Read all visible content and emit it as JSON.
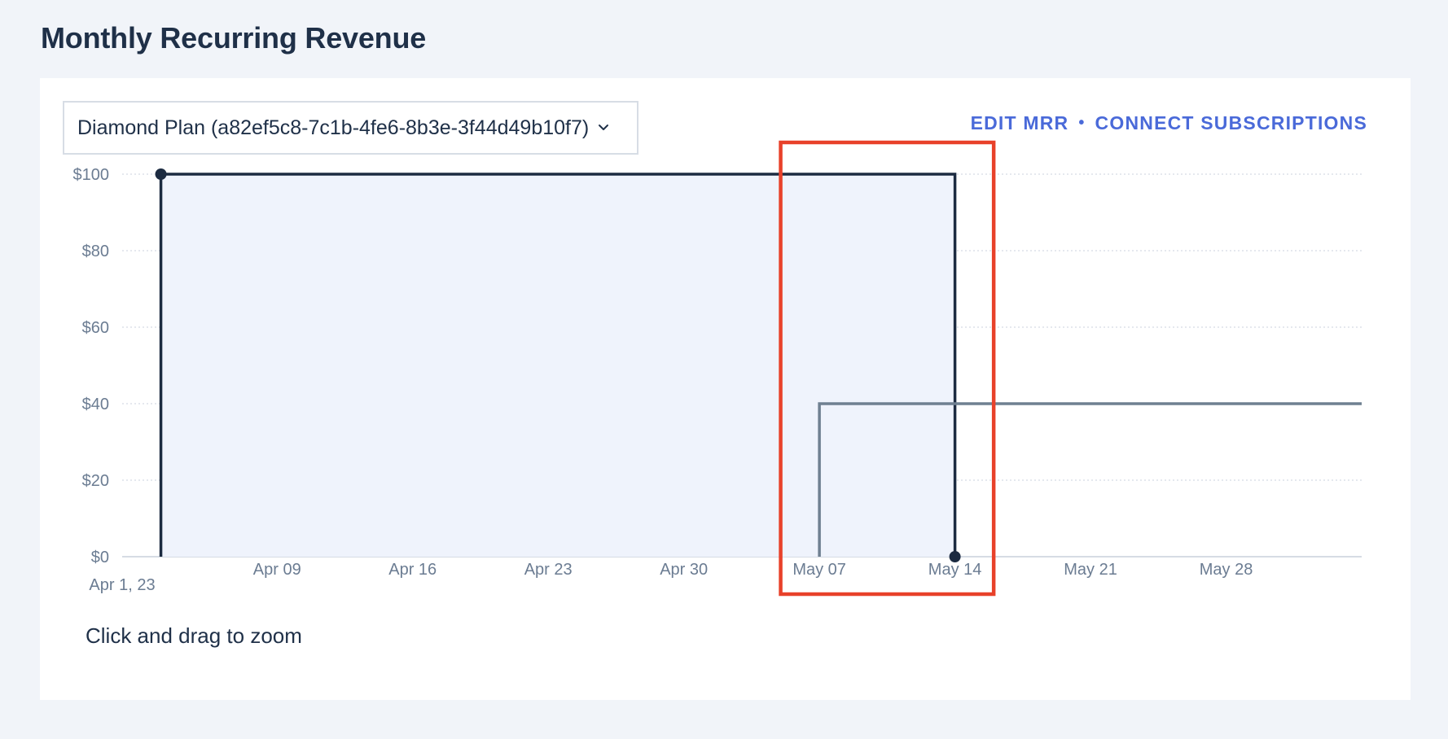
{
  "page": {
    "title": "Monthly Recurring Revenue"
  },
  "plan_select": {
    "value": "Diamond Plan (a82ef5c8-7c1b-4fe6-8b3e-3f44d49b10f7)"
  },
  "actions": {
    "edit_mrr": "EDIT MRR",
    "separator": "•",
    "connect_subscriptions": "CONNECT SUBSCRIPTIONS"
  },
  "zoom_hint": "Click and drag to zoom",
  "colors": {
    "accent": "#4a6ad9",
    "series_primary": "#1c2b41",
    "series_secondary": "#6f8091",
    "area_fill": "#eff3fc",
    "highlight_box": "#e8412a"
  },
  "chart_data": {
    "type": "area",
    "x_domain": [
      "2023-04-01",
      "2023-06-04"
    ],
    "ylim": [
      0,
      100
    ],
    "y_ticks": [
      {
        "value": 0,
        "label": "$0"
      },
      {
        "value": 20,
        "label": "$20"
      },
      {
        "value": 40,
        "label": "$40"
      },
      {
        "value": 60,
        "label": "$60"
      },
      {
        "value": 80,
        "label": "$80"
      },
      {
        "value": 100,
        "label": "$100"
      }
    ],
    "x_ticks": [
      {
        "date": "2023-04-01",
        "label": "Apr 1, 23",
        "offset_down": true
      },
      {
        "date": "2023-04-09",
        "label": "Apr 09"
      },
      {
        "date": "2023-04-16",
        "label": "Apr 16"
      },
      {
        "date": "2023-04-23",
        "label": "Apr 23"
      },
      {
        "date": "2023-04-30",
        "label": "Apr 30"
      },
      {
        "date": "2023-05-07",
        "label": "May 07"
      },
      {
        "date": "2023-05-14",
        "label": "May 14"
      },
      {
        "date": "2023-05-21",
        "label": "May 21"
      },
      {
        "date": "2023-05-28",
        "label": "May 28"
      }
    ],
    "grid": true,
    "series": [
      {
        "style": "step-area",
        "points": [
          {
            "date": "2023-04-03",
            "value": 0
          },
          {
            "date": "2023-04-03",
            "value": 100
          },
          {
            "date": "2023-05-14",
            "value": 100
          },
          {
            "date": "2023-05-14",
            "value": 0
          }
        ],
        "markers": [
          {
            "date": "2023-04-03",
            "value": 100
          },
          {
            "date": "2023-05-14",
            "value": 0
          }
        ]
      },
      {
        "style": "step-line",
        "points": [
          {
            "date": "2023-05-07",
            "value": 0
          },
          {
            "date": "2023-05-07",
            "value": 40
          },
          {
            "date": "2023-06-04",
            "value": 40
          }
        ]
      }
    ],
    "highlight_range": [
      "2023-05-05",
      "2023-05-16"
    ]
  }
}
